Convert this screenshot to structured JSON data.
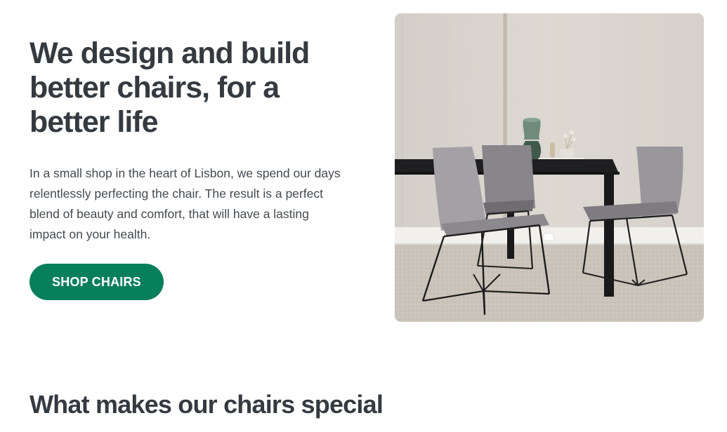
{
  "hero": {
    "title": "We design and build better chairs, for a better life",
    "description": "In a small shop in the heart of Lisbon, we spend our days relentlessly perfecting the chair. The result is a perfect blend of beauty and comfort, that will have a lasting impact on your health.",
    "cta_label": "SHOP CHAIRS",
    "image_subject": "dining-table-with-grey-chairs"
  },
  "features": {
    "heading": "What makes our chairs special"
  },
  "colors": {
    "accent": "#087f5b",
    "text": "#343a40"
  }
}
